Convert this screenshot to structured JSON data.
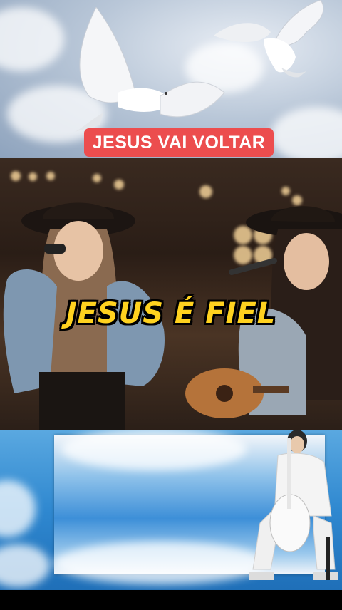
{
  "captions": {
    "top": "JESUS VAI VOLTAR",
    "middle": "JESUS É FIEL"
  },
  "icons": {
    "dove_left": "dove-icon",
    "dove_right": "dove-icon",
    "cellist": "cellist-icon"
  },
  "colors": {
    "top_caption_bg": "#ec4d4e",
    "middle_caption_text": "#ffd21f"
  }
}
